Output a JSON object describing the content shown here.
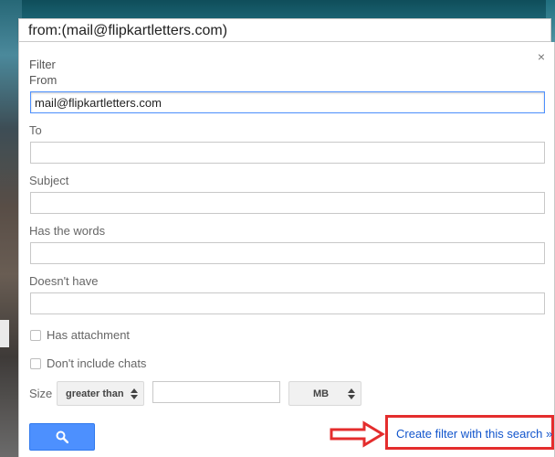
{
  "search": {
    "query": "from:(mail@flipkartletters.com)"
  },
  "filter": {
    "heading_filter": "Filter",
    "heading_from": "From",
    "close_glyph": "×",
    "fields": {
      "from": {
        "value": "mail@flipkartletters.com",
        "placeholder": ""
      },
      "to": {
        "label": "To",
        "value": "",
        "placeholder": ""
      },
      "subject": {
        "label": "Subject",
        "value": "",
        "placeholder": ""
      },
      "has_words": {
        "label": "Has the words",
        "value": "",
        "placeholder": ""
      },
      "doesnt_have": {
        "label": "Doesn't have",
        "value": "",
        "placeholder": ""
      }
    },
    "checkboxes": {
      "has_attachment": "Has attachment",
      "dont_include_chats": "Don't include chats"
    },
    "size": {
      "label": "Size",
      "operator_selected": "greater than",
      "value": "",
      "unit_selected": "MB"
    },
    "search_button": {
      "icon": "search-icon"
    },
    "create_filter_link": "Create filter with this search »"
  },
  "colors": {
    "accent_button": "#4d90fe",
    "link": "#1155cc",
    "highlight_red": "#e42d2d"
  }
}
